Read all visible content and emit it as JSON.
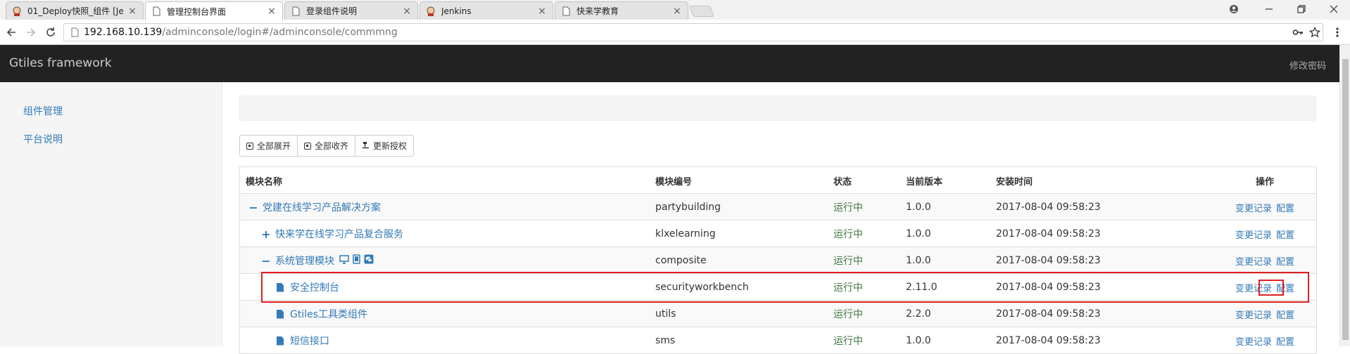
{
  "browser": {
    "tabs": [
      {
        "title": "01_Deploy快照_组件 [Je",
        "favicon": "jenkins-icon",
        "active": false
      },
      {
        "title": "管理控制台界面",
        "favicon": "page-icon",
        "active": true
      },
      {
        "title": "登录组件说明",
        "favicon": "page-icon",
        "active": false
      },
      {
        "title": "Jenkins",
        "favicon": "jenkins-icon",
        "active": false
      },
      {
        "title": "快来学教育",
        "favicon": "page-icon",
        "active": false
      }
    ],
    "url_host": "192.168.10.139",
    "url_path": "/adminconsole/login#/adminconsole/commmng"
  },
  "app": {
    "brand": "Gtiles framework",
    "change_password": "修改密码"
  },
  "sidebar": {
    "items": [
      {
        "label": "组件管理"
      },
      {
        "label": "平台说明"
      }
    ]
  },
  "toolbar": {
    "expand_all": "全部展开",
    "collapse_all": "全部收齐",
    "update_license": "更新授权"
  },
  "table": {
    "headers": {
      "name": "模块名称",
      "code": "模块编号",
      "status": "状态",
      "version": "当前版本",
      "install_time": "安装时间",
      "ops": "操作"
    },
    "op_history": "变更记录",
    "op_config": "配置",
    "rows": [
      {
        "name": "党建在线学习产品解决方案",
        "code": "partybuilding",
        "status": "运行中",
        "version": "1.0.0",
        "install_time": "2017-08-04 09:58:23",
        "toggle": "−",
        "level": 0
      },
      {
        "name": "快来学在线学习产品复合服务",
        "code": "klxelearning",
        "status": "运行中",
        "version": "1.0.0",
        "install_time": "2017-08-04 09:58:23",
        "toggle": "+",
        "level": 1
      },
      {
        "name": "系统管理模块",
        "code": "composite",
        "status": "运行中",
        "version": "1.0.0",
        "install_time": "2017-08-04 09:58:23",
        "toggle": "−",
        "level": 1,
        "device_icons": [
          "desktop-icon",
          "tablet-icon",
          "wechat-icon"
        ]
      },
      {
        "name": "安全控制台",
        "code": "securityworkbench",
        "status": "运行中",
        "version": "2.11.0",
        "install_time": "2017-08-04 09:58:23",
        "leaf": true,
        "level": 2
      },
      {
        "name": "Gtiles工具类组件",
        "code": "utils",
        "status": "运行中",
        "version": "2.2.0",
        "install_time": "2017-08-04 09:58:23",
        "leaf": true,
        "level": 2
      },
      {
        "name": "短信接口",
        "code": "sms",
        "status": "运行中",
        "version": "1.0.0",
        "install_time": "2017-08-04 09:58:23",
        "leaf": true,
        "level": 2
      }
    ]
  },
  "colors": {
    "link": "#337ab7",
    "status_running": "#3c763d",
    "header_bg": "#222222",
    "highlight": "#e02020"
  }
}
